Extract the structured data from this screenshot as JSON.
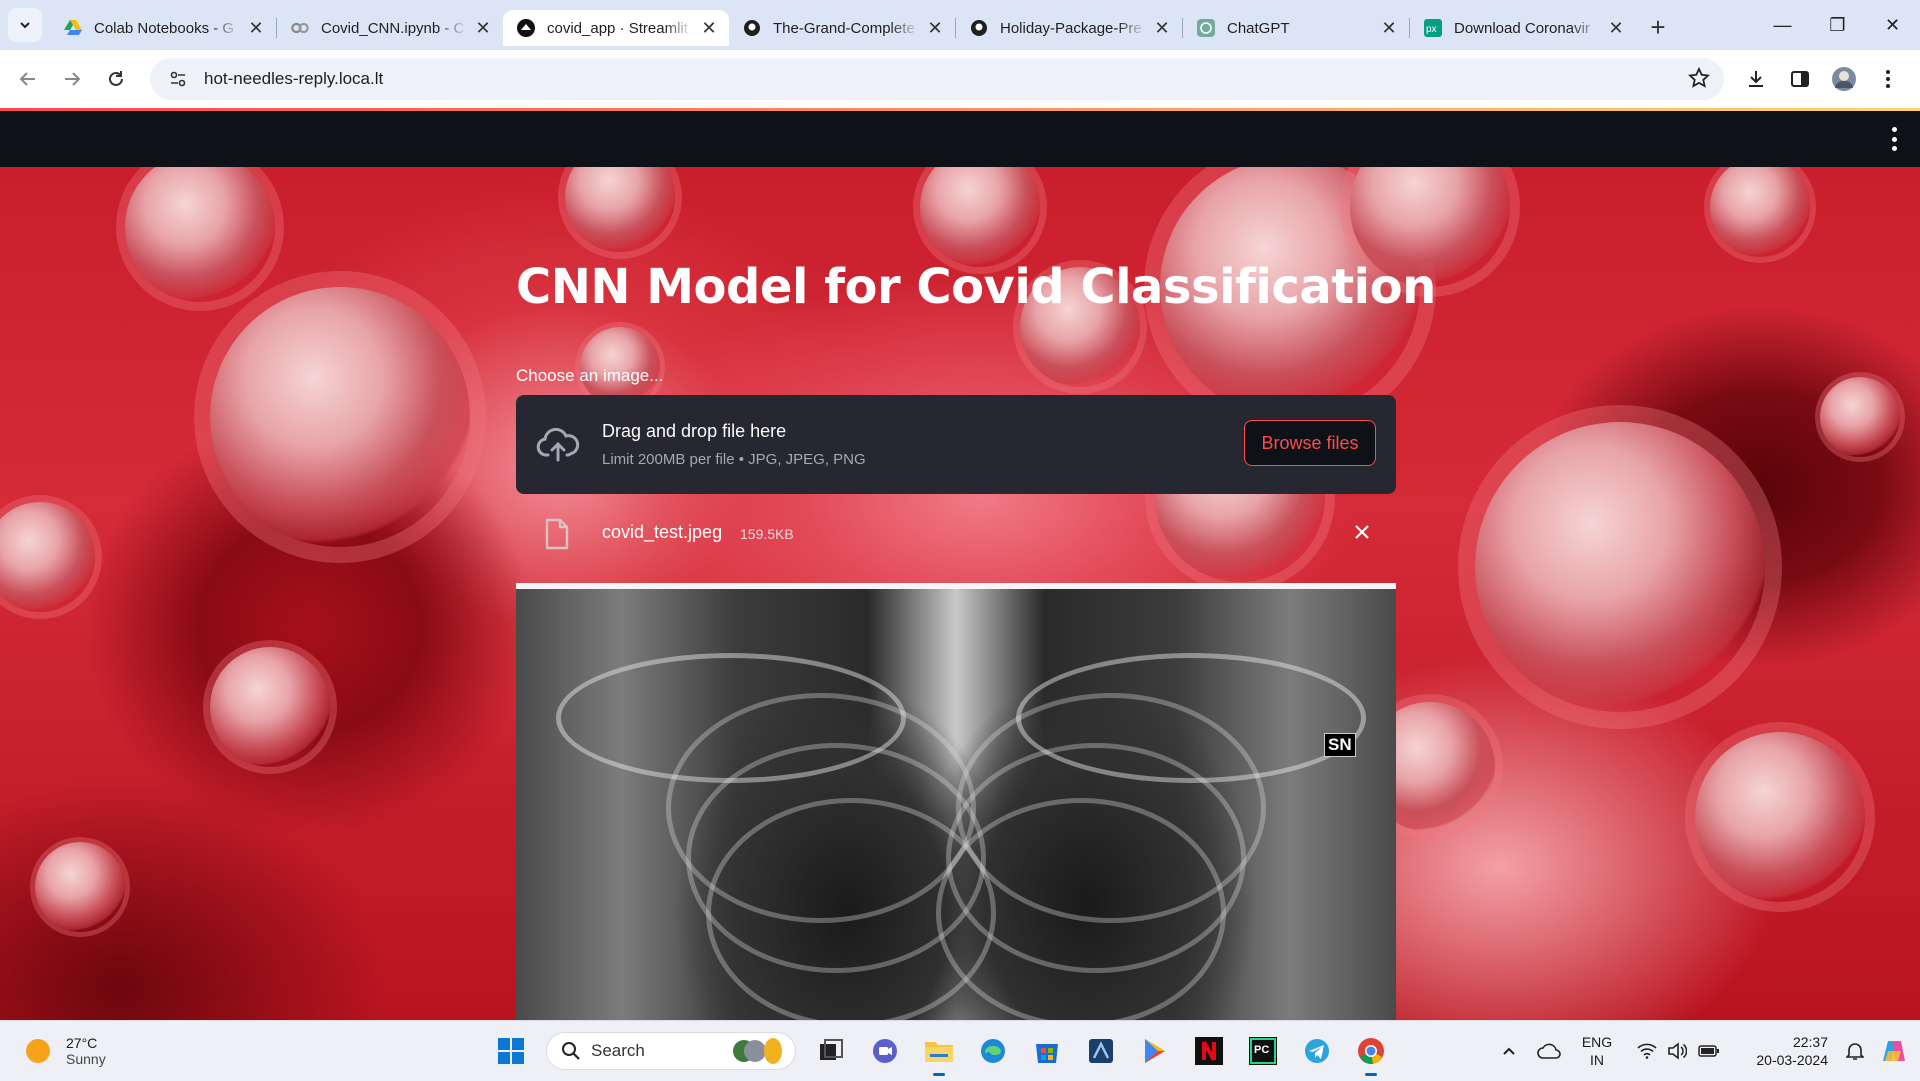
{
  "browser": {
    "tabs": [
      {
        "title": "Colab Notebooks - G",
        "icon": "google-drive-icon"
      },
      {
        "title": "Covid_CNN.ipynb - C",
        "icon": "colab-icon"
      },
      {
        "title": "covid_app · Streamlit",
        "icon": "streamlit-icon",
        "active": true
      },
      {
        "title": "The-Grand-Complete",
        "icon": "github-icon"
      },
      {
        "title": "Holiday-Package-Pre",
        "icon": "github-icon"
      },
      {
        "title": "ChatGPT",
        "icon": "chatgpt-icon"
      },
      {
        "title": "Download Coronavir",
        "icon": "pexels-icon"
      }
    ],
    "url": "hot-needles-reply.loca.lt"
  },
  "app": {
    "title": "CNN Model for Covid Classification",
    "uploader": {
      "label": "Choose an image...",
      "drop_text": "Drag and drop file here",
      "limit_text": "Limit 200MB per file • JPG, JPEG, PNG",
      "browse_label": "Browse files"
    },
    "file": {
      "name": "covid_test.jpeg",
      "size": "159.5KB"
    },
    "xray_label": "SN"
  },
  "taskbar": {
    "weather_temp": "27°C",
    "weather_desc": "Sunny",
    "search_label": "Search",
    "lang_line1": "ENG",
    "lang_line2": "IN",
    "time": "22:37",
    "date": "20-03-2024"
  },
  "colors": {
    "streamlit_accent": "#ff4b4b",
    "streamlit_header": "#0e1117",
    "dropzone_bg": "#262730"
  }
}
